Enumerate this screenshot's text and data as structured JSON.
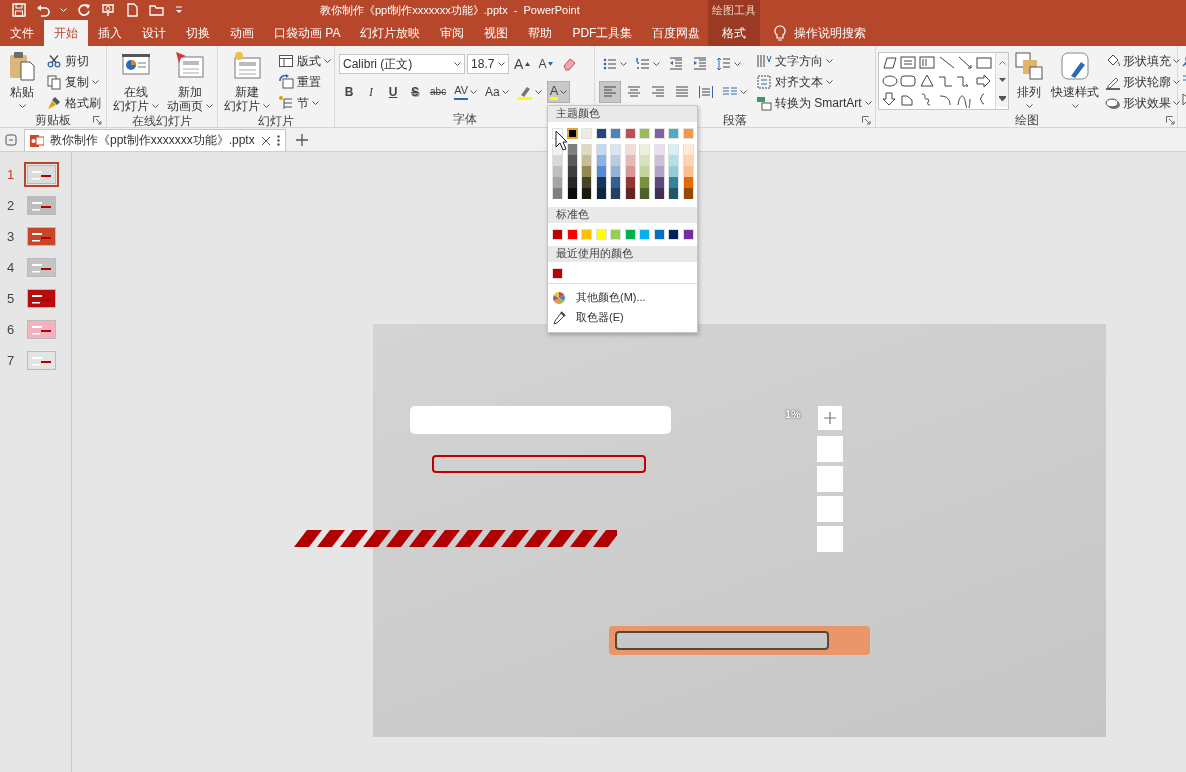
{
  "window": {
    "title": "教你制作《ppt制作xxxxxxx功能》.pptx  -  PowerPoint",
    "context_group": "绘图工具"
  },
  "ribbon_tabs": [
    {
      "label": "文件",
      "selected": false,
      "kind": "normal"
    },
    {
      "label": "开始",
      "selected": true,
      "kind": "normal"
    },
    {
      "label": "插入",
      "selected": false,
      "kind": "normal"
    },
    {
      "label": "设计",
      "selected": false,
      "kind": "normal"
    },
    {
      "label": "切换",
      "selected": false,
      "kind": "normal"
    },
    {
      "label": "动画",
      "selected": false,
      "kind": "normal"
    },
    {
      "label": "口袋动画 PA",
      "selected": false,
      "kind": "normal"
    },
    {
      "label": "幻灯片放映",
      "selected": false,
      "kind": "normal"
    },
    {
      "label": "审阅",
      "selected": false,
      "kind": "normal"
    },
    {
      "label": "视图",
      "selected": false,
      "kind": "normal"
    },
    {
      "label": "帮助",
      "selected": false,
      "kind": "normal"
    },
    {
      "label": "PDF工具集",
      "selected": false,
      "kind": "normal"
    },
    {
      "label": "百度网盘",
      "selected": false,
      "kind": "normal"
    },
    {
      "label": "格式",
      "selected": false,
      "kind": "context"
    }
  ],
  "tell_me": "操作说明搜索",
  "ribbon_groups": [
    {
      "label": "剪贴板",
      "launcher": true,
      "sections": [
        {
          "kind": "large",
          "lines": [
            "粘贴"
          ],
          "dropdown": true
        },
        {
          "kind": "stack",
          "items": [
            {
              "label": "剪切"
            },
            {
              "label": "复制",
              "dropdown": true
            },
            {
              "label": "格式刷"
            }
          ]
        }
      ]
    },
    {
      "label": "在线幻灯片",
      "sections": [
        {
          "kind": "large",
          "lines": [
            "在线",
            "幻灯片"
          ],
          "dropdown": true
        },
        {
          "kind": "large",
          "lines": [
            "新加",
            "动画页"
          ],
          "dropdown": true
        }
      ]
    },
    {
      "label": "幻灯片",
      "sections": [
        {
          "kind": "large",
          "lines": [
            "新建",
            "幻灯片"
          ],
          "dropdown": true
        },
        {
          "kind": "stack",
          "items": [
            {
              "label": "版式",
              "dropdown": true
            },
            {
              "label": "重置"
            },
            {
              "label": "节",
              "dropdown": true
            }
          ]
        }
      ]
    },
    {
      "label": "字体",
      "sections": [
        {
          "kind": "toolbar",
          "items": [
            {
              "kind": "font_name",
              "value": "Calibri (正文)"
            },
            {
              "kind": "font_size",
              "value": "18.7"
            },
            {
              "kind": "grow",
              "label": "A",
              "pressed": false
            },
            {
              "kind": "shrink",
              "label": "A",
              "pressed": false
            },
            {
              "kind": "icon",
              "pressed": false
            }
          ]
        },
        {
          "kind": "toolbar",
          "items": [
            {
              "kind": "bold",
              "label": "B",
              "pressed": false
            },
            {
              "kind": "italic",
              "label": "I",
              "pressed": false
            },
            {
              "kind": "underline",
              "label": "U",
              "pressed": false
            },
            {
              "kind": "shadow",
              "label": "S",
              "pressed": false
            },
            {
              "kind": "strike",
              "label": "abc",
              "pressed": false
            },
            {
              "kind": "spacing",
              "label": "AV",
              "dropdown": true,
              "pressed": false
            },
            {
              "kind": "case",
              "label": "Aa",
              "dropdown": true,
              "pressed": false
            },
            {
              "kind": "icon",
              "dropdown": true,
              "pressed": false
            },
            {
              "kind": "font_color",
              "label": "A",
              "dropdown": true,
              "pressed": true
            }
          ]
        }
      ]
    },
    {
      "label": "段落",
      "launcher": true,
      "sections": [
        {
          "kind": "toolbar",
          "items": [
            {
              "kind": "icon",
              "dropdown": true,
              "pressed": false
            },
            {
              "kind": "icon",
              "dropdown": true,
              "pressed": false
            },
            {
              "kind": "icon",
              "pressed": false
            },
            {
              "kind": "icon",
              "pressed": false
            },
            {
              "kind": "icon",
              "dropdown": true,
              "pressed": false
            }
          ]
        },
        {
          "kind": "toolbar",
          "items": [
            {
              "kind": "icon",
              "pressed": true
            },
            {
              "kind": "icon",
              "pressed": false
            },
            {
              "kind": "icon",
              "pressed": false
            },
            {
              "kind": "icon",
              "pressed": false
            },
            {
              "kind": "icon",
              "pressed": false
            },
            {
              "kind": "icon",
              "dropdown": true,
              "pressed": false
            }
          ]
        },
        {
          "kind": "stack",
          "items": [
            {
              "label": "文字方向",
              "dropdown": true
            },
            {
              "label": "对齐文本",
              "dropdown": true
            },
            {
              "label": "转换为 SmartArt",
              "dropdown": true
            }
          ]
        }
      ]
    },
    {
      "label": "绘图",
      "launcher": true,
      "sections": [
        {
          "kind": "gallery"
        },
        {
          "kind": "large",
          "lines": [
            "排列"
          ],
          "dropdown": true
        },
        {
          "kind": "large",
          "lines": [
            "快速样式"
          ],
          "dropdown": true
        },
        {
          "kind": "stack",
          "items": [
            {
              "label": "形状填充",
              "dropdown": true
            },
            {
              "label": "形状轮廓",
              "dropdown": true
            },
            {
              "label": "形状效果",
              "dropdown": true
            }
          ]
        }
      ]
    }
  ],
  "document_tab": {
    "title": "教你制作《ppt制作xxxxxxx功能》.pptx"
  },
  "slides": [
    {
      "number": "1",
      "selected": true,
      "color": "#dcdcdc"
    },
    {
      "number": "2",
      "selected": false,
      "color": "#bdbdbd"
    },
    {
      "number": "3",
      "selected": false,
      "color": "#c9452a"
    },
    {
      "number": "4",
      "selected": false,
      "color": "#c4c4c4"
    },
    {
      "number": "5",
      "selected": false,
      "color": "#b80d0d"
    },
    {
      "number": "6",
      "selected": false,
      "color": "#f2b3bf"
    },
    {
      "number": "7",
      "selected": false,
      "color": "#e4e4e4"
    }
  ],
  "slide": {
    "percent_label": "1%"
  },
  "font_color_menu": {
    "theme_header": "主题颜色",
    "theme_colors": [
      {
        "color": "#ffffff",
        "selected": false,
        "shades": [
          {
            "color": "#f2f2f2"
          },
          {
            "color": "#d8d8d8"
          },
          {
            "color": "#bfbfbf"
          },
          {
            "color": "#a5a5a5"
          },
          {
            "color": "#7f7f7f"
          }
        ]
      },
      {
        "color": "#000000",
        "selected": true,
        "shades": [
          {
            "color": "#7f7f7f"
          },
          {
            "color": "#595959"
          },
          {
            "color": "#3f3f3f"
          },
          {
            "color": "#262626"
          },
          {
            "color": "#0c0c0c"
          }
        ]
      },
      {
        "color": "#eeece1",
        "selected": false,
        "shades": [
          {
            "color": "#ddd9c3"
          },
          {
            "color": "#c4bd97"
          },
          {
            "color": "#938953"
          },
          {
            "color": "#494429"
          },
          {
            "color": "#1d1b10"
          }
        ]
      },
      {
        "color": "#1f497d",
        "selected": false,
        "shades": [
          {
            "color": "#c6d9f0"
          },
          {
            "color": "#8db3e2"
          },
          {
            "color": "#548dd4"
          },
          {
            "color": "#17365d"
          },
          {
            "color": "#0f243e"
          }
        ]
      },
      {
        "color": "#4f81bd",
        "selected": false,
        "shades": [
          {
            "color": "#dbe5f1"
          },
          {
            "color": "#b8cce4"
          },
          {
            "color": "#95b3d7"
          },
          {
            "color": "#366092"
          },
          {
            "color": "#244061"
          }
        ]
      },
      {
        "color": "#c0504d",
        "selected": false,
        "shades": [
          {
            "color": "#f2dcdb"
          },
          {
            "color": "#e5b9b7"
          },
          {
            "color": "#d99694"
          },
          {
            "color": "#953734"
          },
          {
            "color": "#632423"
          }
        ]
      },
      {
        "color": "#9bbb59",
        "selected": false,
        "shades": [
          {
            "color": "#ebf1dd"
          },
          {
            "color": "#d7e3bc"
          },
          {
            "color": "#c3d69b"
          },
          {
            "color": "#76923c"
          },
          {
            "color": "#4f6128"
          }
        ]
      },
      {
        "color": "#8064a2",
        "selected": false,
        "shades": [
          {
            "color": "#e5e0ec"
          },
          {
            "color": "#ccc1d9"
          },
          {
            "color": "#b2a2c7"
          },
          {
            "color": "#5f497a"
          },
          {
            "color": "#3f3151"
          }
        ]
      },
      {
        "color": "#4bacc6",
        "selected": false,
        "shades": [
          {
            "color": "#dbeef3"
          },
          {
            "color": "#b7dde8"
          },
          {
            "color": "#92cddc"
          },
          {
            "color": "#31859b"
          },
          {
            "color": "#205867"
          }
        ]
      },
      {
        "color": "#f79646",
        "selected": false,
        "shades": [
          {
            "color": "#fdeada"
          },
          {
            "color": "#fbd5b5"
          },
          {
            "color": "#fac08f"
          },
          {
            "color": "#e36c09"
          },
          {
            "color": "#974806"
          }
        ]
      }
    ],
    "standard_header": "标准色",
    "standard_colors": [
      {
        "color": "#c00000"
      },
      {
        "color": "#ff0000"
      },
      {
        "color": "#ffc000"
      },
      {
        "color": "#ffff00"
      },
      {
        "color": "#92d050"
      },
      {
        "color": "#00b050"
      },
      {
        "color": "#00b0f0"
      },
      {
        "color": "#0070c0"
      },
      {
        "color": "#002060"
      },
      {
        "color": "#7030a0"
      }
    ],
    "recent_header": "最近使用的颜色",
    "recent_colors": [
      {
        "color": "#c00000"
      }
    ],
    "more_colors": "其他颜色(M)...",
    "eyedropper": "取色器(E)"
  }
}
